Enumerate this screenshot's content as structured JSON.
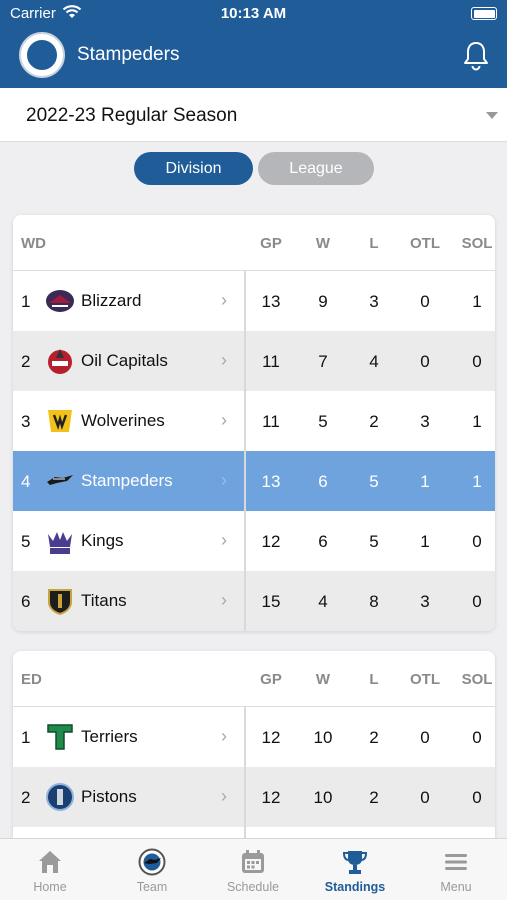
{
  "status": {
    "carrier": "Carrier",
    "time": "10:13 AM"
  },
  "header": {
    "title": "Stampeders"
  },
  "season": {
    "selected": "2022-23 Regular Season"
  },
  "segments": {
    "division": "Division",
    "league": "League"
  },
  "columns": [
    "GP",
    "W",
    "L",
    "OTL",
    "SOL"
  ],
  "divisions": [
    {
      "name": "WD",
      "teams": [
        {
          "rank": "1",
          "name": "Blizzard",
          "gp": "13",
          "w": "9",
          "l": "3",
          "otl": "0",
          "sol": "1"
        },
        {
          "rank": "2",
          "name": "Oil Capitals",
          "gp": "11",
          "w": "7",
          "l": "4",
          "otl": "0",
          "sol": "0"
        },
        {
          "rank": "3",
          "name": "Wolverines",
          "gp": "11",
          "w": "5",
          "l": "2",
          "otl": "3",
          "sol": "1"
        },
        {
          "rank": "4",
          "name": "Stampeders",
          "gp": "13",
          "w": "6",
          "l": "5",
          "otl": "1",
          "sol": "1"
        },
        {
          "rank": "5",
          "name": "Kings",
          "gp": "12",
          "w": "6",
          "l": "5",
          "otl": "1",
          "sol": "0"
        },
        {
          "rank": "6",
          "name": "Titans",
          "gp": "15",
          "w": "4",
          "l": "8",
          "otl": "3",
          "sol": "0"
        }
      ]
    },
    {
      "name": "ED",
      "teams": [
        {
          "rank": "1",
          "name": "Terriers",
          "gp": "12",
          "w": "10",
          "l": "2",
          "otl": "0",
          "sol": "0"
        },
        {
          "rank": "2",
          "name": "Pistons",
          "gp": "12",
          "w": "10",
          "l": "2",
          "otl": "0",
          "sol": "0"
        }
      ]
    }
  ],
  "tabs": {
    "home": "Home",
    "team": "Team",
    "schedule": "Schedule",
    "standings": "Standings",
    "menu": "Menu"
  },
  "colors": {
    "primary": "#1f5c98",
    "highlight": "#6fa3dd",
    "inactive": "#9a9a9a"
  }
}
